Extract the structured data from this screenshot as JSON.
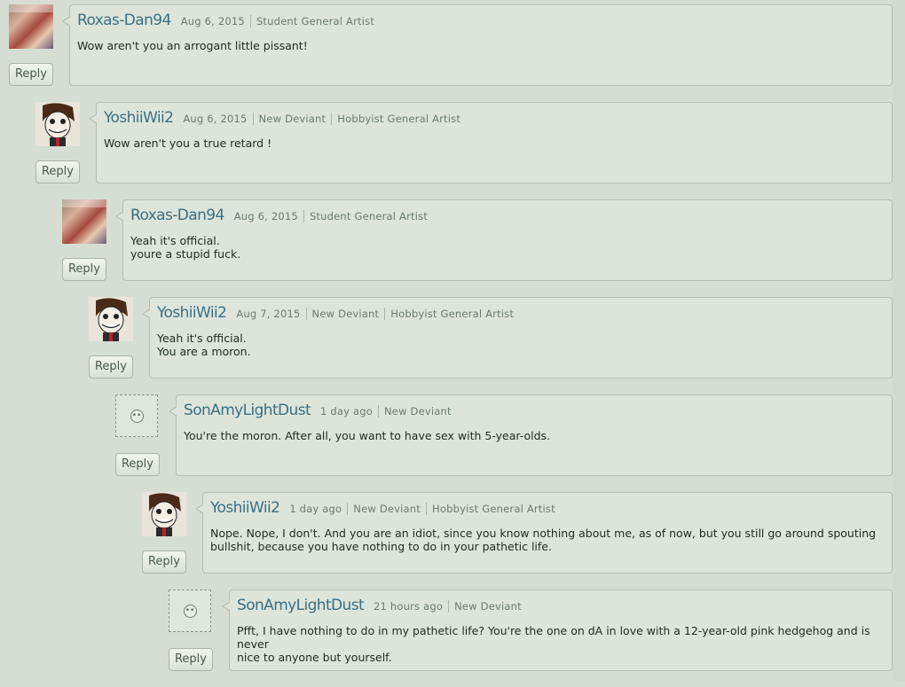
{
  "comments": [
    {
      "username": "Roxas-Dan94",
      "date": "Aug 6, 2015",
      "tags": [
        "Student General Artist"
      ],
      "avatar": "kingdom-hearts-avatar",
      "lines": [
        "Wow aren't you an arrogant little pissant!"
      ],
      "reply": "Reply"
    },
    {
      "username": "YoshiiWii2",
      "date": "Aug 6, 2015",
      "tags": [
        "New Deviant",
        "Hobbyist General Artist"
      ],
      "avatar": "cartoon-face-avatar",
      "lines": [
        "Wow aren't you a true retard !"
      ],
      "reply": "Reply"
    },
    {
      "username": "Roxas-Dan94",
      "date": "Aug 6, 2015",
      "tags": [
        "Student General Artist"
      ],
      "avatar": "kingdom-hearts-avatar",
      "lines": [
        "Yeah it's official.",
        "youre a stupid fuck."
      ],
      "reply": "Reply"
    },
    {
      "username": "YoshiiWii2",
      "date": "Aug 7, 2015",
      "tags": [
        "New Deviant",
        "Hobbyist General Artist"
      ],
      "avatar": "cartoon-face-avatar",
      "lines": [
        "Yeah it's official.",
        "You are a moron."
      ],
      "reply": "Reply"
    },
    {
      "username": "SonAmyLightDust",
      "date": "1 day ago",
      "tags": [
        "New Deviant"
      ],
      "avatar": "default-avatar",
      "lines": [
        "You're the moron. After all, you want to have sex with 5-year-olds."
      ],
      "reply": "Reply"
    },
    {
      "username": "YoshiiWii2",
      "date": "1 day ago",
      "tags": [
        "New Deviant",
        "Hobbyist General Artist"
      ],
      "avatar": "cartoon-face-avatar",
      "lines": [
        "Nope. Nope, I don't. And you are an idiot, since you know nothing about me, as of now, but you still go around spouting",
        "bullshit, because you have nothing to do in your pathetic life."
      ],
      "reply": "Reply"
    },
    {
      "username": "SonAmyLightDust",
      "date": "21 hours ago",
      "tags": [
        "New Deviant"
      ],
      "avatar": "default-avatar",
      "lines": [
        "Pfft, I have nothing to do in my pathetic life? You're the one on dA in love with a 12-year-old pink hedgehog and is never",
        "nice to anyone but yourself."
      ],
      "reply": "Reply"
    }
  ],
  "colors": {
    "background": "#d6ded4",
    "bubble": "#dde5db",
    "username": "#3b6f82",
    "meta": "#6b7a6e"
  }
}
